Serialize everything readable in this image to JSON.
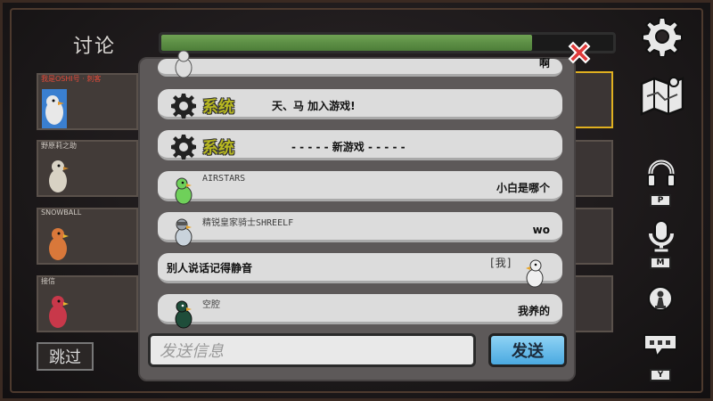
{
  "screen": {
    "title": "讨论"
  },
  "timer": {
    "progress": 0.82,
    "color": "#5c9446"
  },
  "players": [
    {
      "name": "我是OSHI号 · 刺客",
      "self": true
    },
    {
      "name": "野原莉之助",
      "self": false
    },
    {
      "name": "SNOWBALL",
      "self": false
    },
    {
      "name": "接信",
      "self": false
    }
  ],
  "skip_label": "跳过",
  "side_icons": {
    "settings": "gear-icon",
    "map": "map-icon",
    "headphones_key": "P",
    "mic_key": "M",
    "chat_key": "Y"
  },
  "chat": {
    "messages": [
      {
        "type": "player",
        "name": "",
        "text": "啊",
        "avatar_color": "#dddddd"
      },
      {
        "type": "system",
        "label": "系统",
        "text": "天、马 加入游戏!"
      },
      {
        "type": "system",
        "label": "系统",
        "text": "- - - - - 新游戏 - - - - -"
      },
      {
        "type": "player",
        "name": "AIRSTARS",
        "text": "小白是哪个",
        "avatar_color": "#6fd05a"
      },
      {
        "type": "player",
        "name": "精锐皇家骑士SHREELF",
        "text": "wo",
        "avatar_color": "#9aa0a8"
      },
      {
        "type": "self",
        "tag": "[我]",
        "text": "别人说话记得静音",
        "avatar_color": "#f0f0f0"
      },
      {
        "type": "player",
        "name": "空腔",
        "text": "我养的",
        "avatar_color": "#1f4d3a"
      }
    ],
    "input_placeholder": "发送信息",
    "send_label": "发送"
  },
  "colors": {
    "accent_blue": "#5bb8ea",
    "close_red": "#e03a3a",
    "system_yellow": "#b8b820"
  }
}
